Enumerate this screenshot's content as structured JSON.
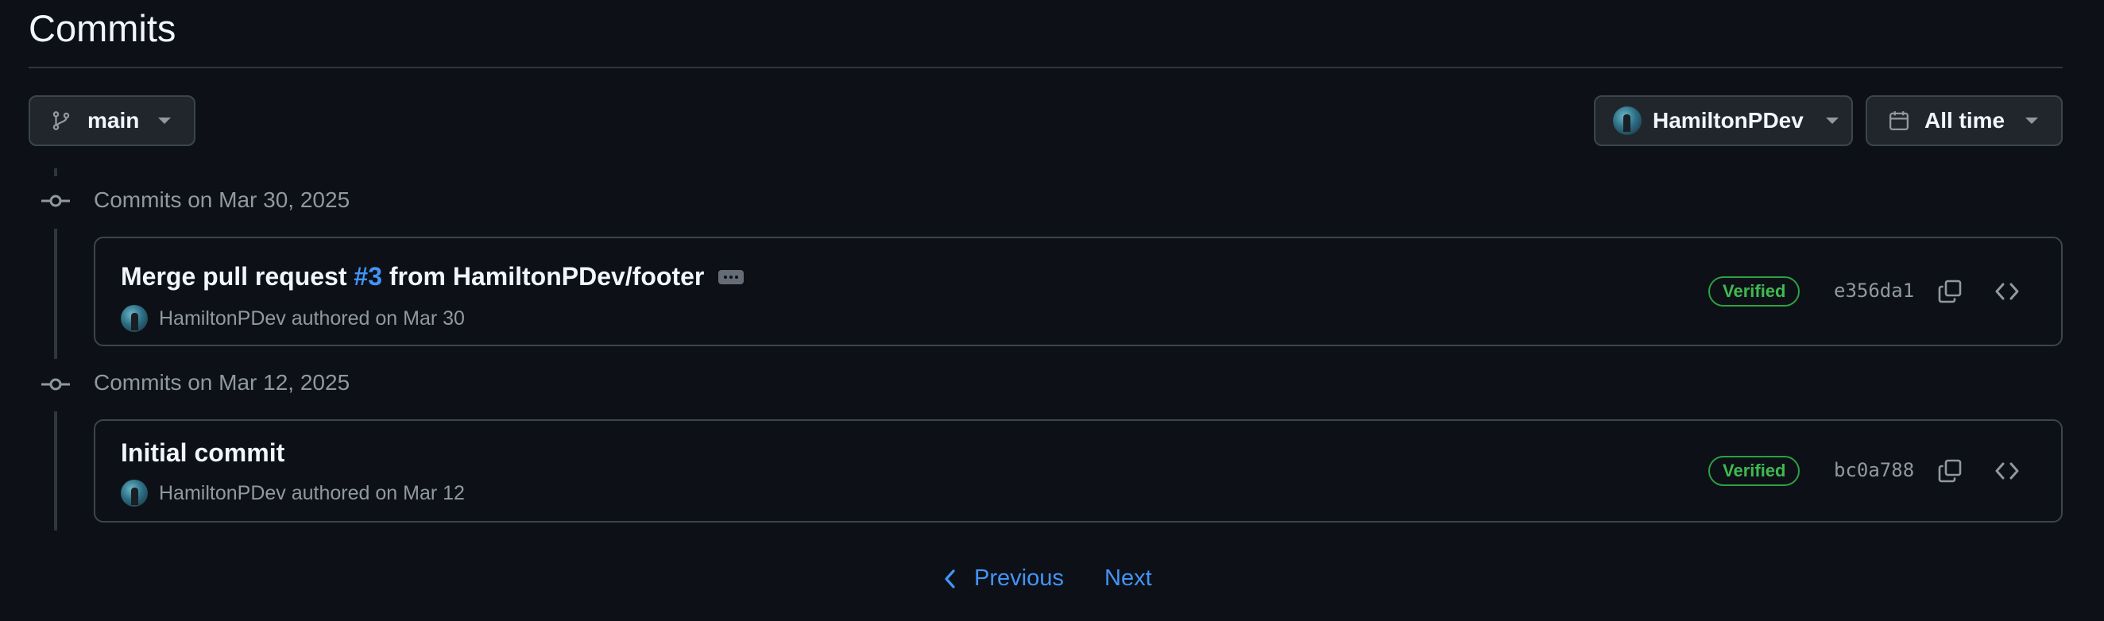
{
  "page": {
    "title": "Commits"
  },
  "toolbar": {
    "branch_label": "main",
    "author_label": "HamiltonPDev",
    "time_label": "All time"
  },
  "groups": [
    {
      "label": "Commits on Mar 30, 2025",
      "commit": {
        "message_prefix": "Merge pull request ",
        "pr_link": "#3",
        "message_suffix": " from HamiltonPDev/footer",
        "author": "HamiltonPDev",
        "authored_text": "authored on Mar 30",
        "verified": "Verified",
        "sha": "e356da1"
      }
    },
    {
      "label": "Commits on Mar 12, 2025",
      "commit": {
        "message": "Initial commit",
        "author": "HamiltonPDev",
        "authored_text": "authored on Mar 12",
        "verified": "Verified",
        "sha": "bc0a788"
      }
    }
  ],
  "pagination": {
    "previous": "Previous",
    "next": "Next"
  },
  "colors": {
    "background": "#0d1117",
    "link": "#4493f8",
    "verified": "#3fb950",
    "border": "#3d444d"
  },
  "icons": [
    "git-branch-icon",
    "caret-down-icon",
    "avatar",
    "calendar-icon",
    "git-commit-icon",
    "ellipsis-icon",
    "copy-icon",
    "code-icon",
    "chevron-left-icon"
  ]
}
